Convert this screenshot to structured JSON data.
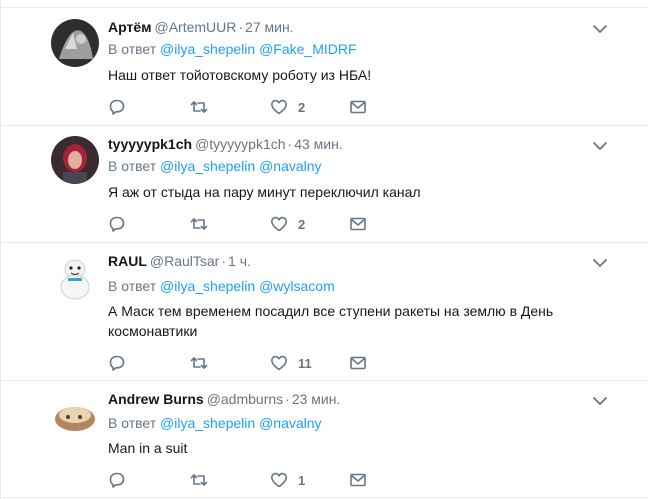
{
  "reply_prefix": "В ответ",
  "tweets": [
    {
      "fullname": "Артём",
      "username": "@ArtemUUR",
      "separator": "·",
      "time": "27 мин.",
      "mentions": [
        "@ilya_shepelin",
        "@Fake_MIDRF"
      ],
      "text": "Наш ответ тойотовскому роботу из НБА!",
      "reply_count": "",
      "retweet_count": "",
      "like_count": "2",
      "avatar_colors": [
        "#3a3a3a",
        "#bdbdbd"
      ]
    },
    {
      "fullname": "tyyyyypk1ch",
      "username": "@tyyyyypk1ch",
      "separator": "·",
      "time": "43 мин.",
      "mentions": [
        "@ilya_shepelin",
        "@navalny"
      ],
      "text": "Я аж от стыда на пару минут переключил канал",
      "reply_count": "",
      "retweet_count": "",
      "like_count": "2",
      "avatar_colors": [
        "#8a1c2b",
        "#d8a38a"
      ]
    },
    {
      "fullname": "RAUL",
      "username": "@RaulTsar",
      "separator": "·",
      "time": "1 ч.",
      "mentions": [
        "@ilya_shepelin",
        "@wylsacom"
      ],
      "text": "А Маск тем временем посадил все ступени ракеты на землю в День космонавтики",
      "reply_count": "",
      "retweet_count": "",
      "like_count": "11",
      "avatar_colors": [
        "#f4f4f4",
        "#3aa7c9"
      ]
    },
    {
      "fullname": "Andrew Burns",
      "username": "@admburns",
      "separator": "·",
      "time": "23 мин.",
      "mentions": [
        "@ilya_shepelin",
        "@navalny"
      ],
      "text": "Man in a suit",
      "reply_count": "",
      "retweet_count": "",
      "like_count": "1",
      "avatar_colors": [
        "#a67c52",
        "#e6d3b3"
      ]
    }
  ],
  "icons": {
    "reply": "reply-icon",
    "retweet": "retweet-icon",
    "like": "heart-icon",
    "dm": "envelope-icon",
    "caret": "chevron-down-icon"
  },
  "colors": {
    "link": "#1da1f2",
    "muted": "#657786",
    "text": "#14171a",
    "border": "#e6ecf0"
  }
}
